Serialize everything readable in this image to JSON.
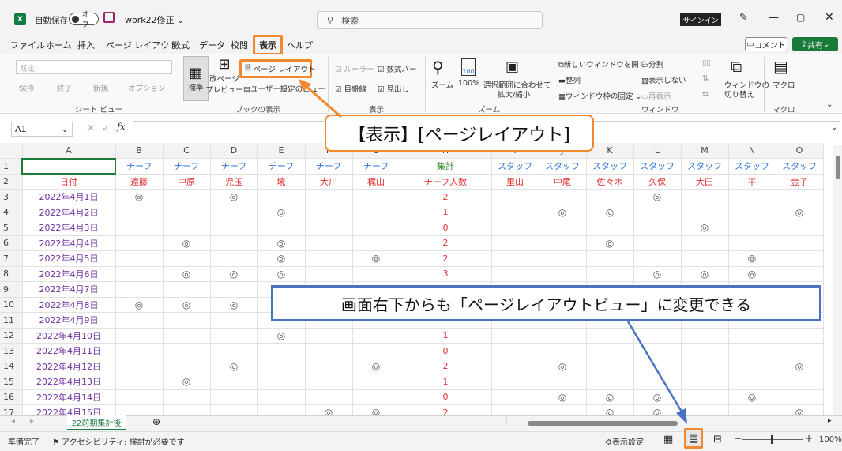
{
  "titlebar": {
    "autosave": "自動保存",
    "toggle": "オフ",
    "filename": "work22修正 ⌄",
    "search": "検索",
    "signin": "サインイン"
  },
  "menu": [
    "ファイル",
    "ホーム",
    "挿入",
    "ページ レイアウト",
    "数式",
    "データ",
    "校閲",
    "表示",
    "ヘルプ"
  ],
  "menu_active_index": 7,
  "comment_btn": "コメント",
  "share_btn": "共有",
  "ribbon": {
    "sheetview": {
      "dropdown": "既定",
      "keep": "保持",
      "exit": "終了",
      "new": "新規",
      "options": "オプション",
      "group": "シート ビュー"
    },
    "bookview": {
      "normal": "標準",
      "pagebreak1": "改ページ",
      "pagebreak2": "プレビュー",
      "pagelayout": "ページ レイアウト",
      "custom": "ユーザー設定のビュー",
      "group": "ブックの表示"
    },
    "show": {
      "ruler": "ルーラー",
      "formulabar": "数式バー",
      "gridlines": "目盛線",
      "headings": "見出し",
      "group": "表示"
    },
    "zoom": {
      "zoom": "ズーム",
      "z100": "100%",
      "sel1": "選択範囲に合わせて",
      "sel2": "拡大/縮小",
      "group": "ズーム"
    },
    "window": {
      "newwin": "新しいウィンドウを開く",
      "arrange": "整列",
      "freeze": "ウィンドウ枠の固定",
      "split": "分割",
      "hide": "表示しない",
      "unhide": "再表示",
      "switch1": "ウィンドウの",
      "switch2": "切り替え",
      "group": "ウィンドウ"
    },
    "macro": {
      "label": "マクロ",
      "group": "マクロ"
    }
  },
  "namebox": "A1",
  "fx": "fx",
  "callouts": {
    "view": "【表示】[ページレイアウト]",
    "bottom": "画面右下からも「ページレイアウトビュー」に変更できる"
  },
  "columns": [
    "A",
    "B",
    "C",
    "D",
    "E",
    "F",
    "G",
    "H",
    "I",
    "J",
    "K",
    "L",
    "M",
    "N",
    "O"
  ],
  "row1": [
    "",
    "チーフ",
    "チーフ",
    "チーフ",
    "チーフ",
    "チーフ",
    "チーフ",
    "集計",
    "スタッフ",
    "スタッフ",
    "スタッフ",
    "スタッフ",
    "スタッフ",
    "スタッフ",
    "スタッフ"
  ],
  "row2": [
    "日付",
    "遠藤",
    "中原",
    "児玉",
    "境",
    "大川",
    "梶山",
    "チーフ人数",
    "里山",
    "中尾",
    "佐々木",
    "久保",
    "大田",
    "平",
    "金子"
  ],
  "rows": [
    {
      "n": "3",
      "date": "2022年4月1日",
      "m": [
        1,
        0,
        1,
        0,
        0,
        0
      ],
      "cnt": "2",
      "s": [
        0,
        0,
        0,
        1,
        0,
        0,
        0
      ]
    },
    {
      "n": "4",
      "date": "2022年4月2日",
      "m": [
        0,
        0,
        0,
        1,
        0,
        0
      ],
      "cnt": "1",
      "s": [
        0,
        1,
        1,
        0,
        0,
        0,
        1
      ]
    },
    {
      "n": "5",
      "date": "2022年4月3日",
      "m": [
        0,
        0,
        0,
        0,
        0,
        0
      ],
      "cnt": "0",
      "s": [
        0,
        0,
        0,
        0,
        1,
        0,
        0
      ]
    },
    {
      "n": "6",
      "date": "2022年4月4日",
      "m": [
        0,
        1,
        0,
        1,
        0,
        0
      ],
      "cnt": "2",
      "s": [
        0,
        0,
        1,
        0,
        0,
        0,
        0
      ]
    },
    {
      "n": "7",
      "date": "2022年4月5日",
      "m": [
        0,
        0,
        0,
        1,
        0,
        1
      ],
      "cnt": "2",
      "s": [
        0,
        0,
        0,
        0,
        0,
        1,
        0
      ]
    },
    {
      "n": "8",
      "date": "2022年4月6日",
      "m": [
        0,
        1,
        1,
        1,
        0,
        0
      ],
      "cnt": "3",
      "s": [
        0,
        0,
        0,
        1,
        1,
        1,
        0
      ]
    },
    {
      "n": "9",
      "date": "2022年4月7日",
      "m": [
        0,
        0,
        0,
        0,
        1,
        0
      ],
      "cnt": "1",
      "s": [
        0,
        0,
        0,
        0,
        0,
        0,
        0
      ]
    },
    {
      "n": "10",
      "date": "2022年4月8日",
      "m": [
        1,
        1,
        1,
        0,
        0,
        0
      ],
      "cnt": "",
      "s": [
        0,
        0,
        0,
        0,
        0,
        0,
        0
      ]
    },
    {
      "n": "11",
      "date": "2022年4月9日",
      "m": [
        0,
        0,
        0,
        0,
        0,
        0
      ],
      "cnt": "",
      "s": [
        0,
        0,
        0,
        0,
        0,
        0,
        0
      ]
    },
    {
      "n": "12",
      "date": "2022年4月10日",
      "m": [
        0,
        0,
        0,
        1,
        0,
        0
      ],
      "cnt": "1",
      "s": [
        0,
        0,
        0,
        0,
        0,
        0,
        0
      ]
    },
    {
      "n": "13",
      "date": "2022年4月11日",
      "m": [
        0,
        0,
        0,
        0,
        0,
        0
      ],
      "cnt": "0",
      "s": [
        0,
        0,
        0,
        0,
        0,
        0,
        0
      ]
    },
    {
      "n": "14",
      "date": "2022年4月12日",
      "m": [
        0,
        0,
        1,
        0,
        0,
        1
      ],
      "cnt": "2",
      "s": [
        0,
        1,
        0,
        0,
        0,
        0,
        1
      ]
    },
    {
      "n": "15",
      "date": "2022年4月13日",
      "m": [
        0,
        1,
        0,
        0,
        0,
        0
      ],
      "cnt": "1",
      "s": [
        0,
        0,
        0,
        0,
        0,
        0,
        0
      ]
    },
    {
      "n": "16",
      "date": "2022年4月14日",
      "m": [
        0,
        0,
        0,
        0,
        0,
        0
      ],
      "cnt": "0",
      "s": [
        0,
        1,
        1,
        1,
        0,
        1,
        0
      ]
    },
    {
      "n": "17",
      "date": "2022年4月15日",
      "m": [
        0,
        0,
        0,
        0,
        1,
        1
      ],
      "cnt": "2",
      "s": [
        0,
        0,
        1,
        1,
        0,
        0,
        1
      ]
    }
  ],
  "mark": "◎",
  "sheet_tab": "22前期集計後",
  "status": {
    "ready": "準備完了",
    "access": "アクセシビリティ: 検討が必要です",
    "display": "表示設定",
    "zoom": "100%"
  }
}
